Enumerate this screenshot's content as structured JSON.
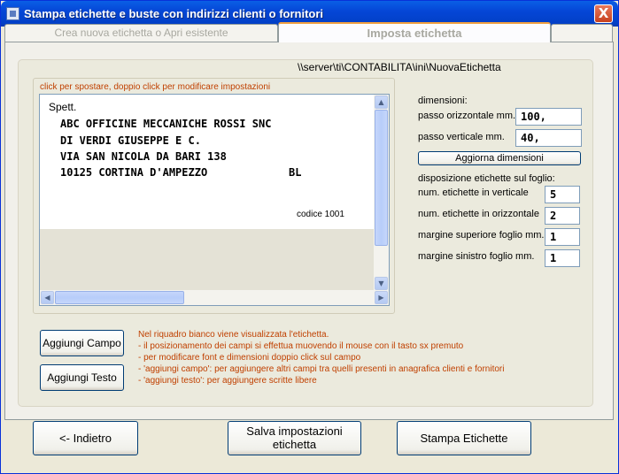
{
  "window": {
    "title": "Stampa etichette e buste con indirizzi clienti o fornitori",
    "close_symbol": "X"
  },
  "tabs": [
    {
      "label": "Crea nuova etichetta o Apri esistente"
    },
    {
      "label": "Imposta etichetta"
    },
    {
      "label": ""
    }
  ],
  "path": "\\\\server\\ti\\CONTABILITA\\ini\\NuovaEtichetta",
  "label_frame": {
    "hint": "click per spostare, doppio click per modificare impostazioni",
    "salutation": "Spett.",
    "lines": [
      "ABC OFFICINE MECCANICHE ROSSI SNC",
      "DI VERDI GIUSEPPE E C.",
      "VIA SAN NICOLA DA BARI 138",
      "10125  CORTINA D'AMPEZZO"
    ],
    "province": "BL",
    "code": "codice  1001"
  },
  "dimensions": {
    "heading": "dimensioni:",
    "horizontal_label": "passo orizzontale mm.",
    "horizontal_value": "100,",
    "vertical_label": "passo verticale mm.",
    "vertical_value": "40,",
    "update_button": "Aggiorna dimensioni"
  },
  "layout": {
    "heading": "disposizione etichette sul foglio:",
    "vertical_count_label": "num. etichette in verticale",
    "vertical_count_value": "5",
    "horizontal_count_label": "num. etichette in orizzontale",
    "horizontal_count_value": "2",
    "top_margin_label": "margine superiore foglio mm.",
    "top_margin_value": "1",
    "left_margin_label": "margine sinistro foglio mm.",
    "left_margin_value": "1"
  },
  "actions": {
    "add_field": "Aggiungi Campo",
    "add_text": "Aggiungi Testo"
  },
  "info_lines": [
    "Nel riquadro bianco viene visualizzata l'etichetta.",
    "- il posizionamento dei campi si effettua muovendo il mouse con il tasto sx premuto",
    "- per modificare font e dimensioni doppio click sul campo",
    "- 'aggiungi campo': per aggiungere altri campi tra quelli presenti in anagrafica clienti e fornitori",
    "- 'aggiungi testo': per aggiungere scritte libere"
  ],
  "footer": {
    "back": "<- Indietro",
    "save_line1": "Salva impostazioni",
    "save_line2": "etichetta",
    "print": "Stampa Etichette"
  },
  "icons": {
    "scroll_up": "▲",
    "scroll_down": "▼",
    "scroll_left": "◀",
    "scroll_right": "▶"
  }
}
